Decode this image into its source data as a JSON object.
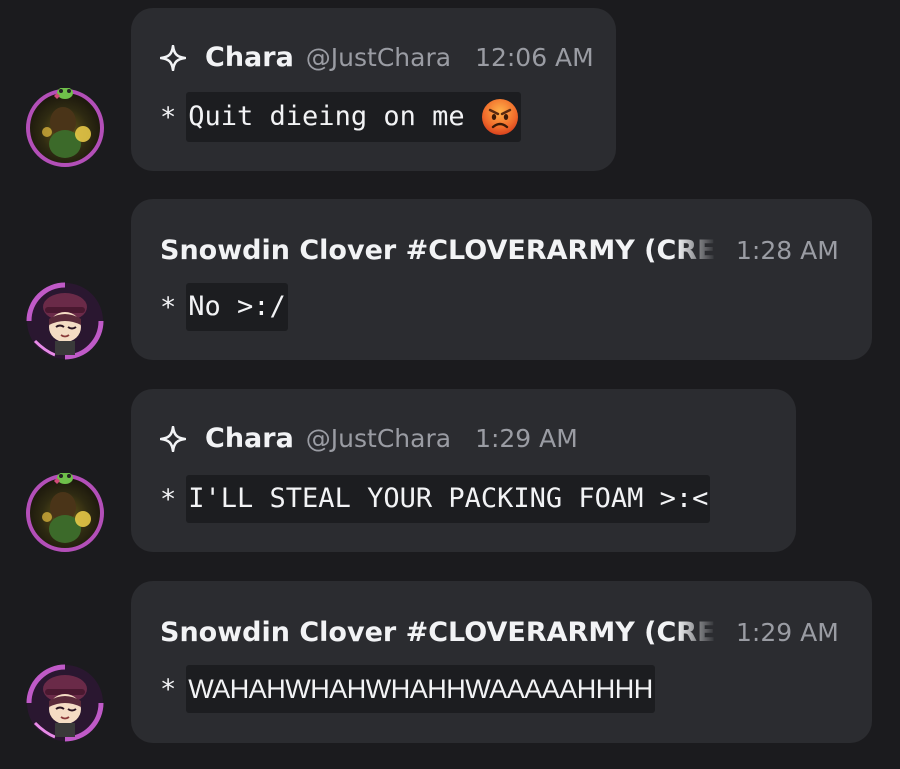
{
  "messages": [
    {
      "author": "Chara",
      "handle": "@JustChara",
      "time": "12:06 AM",
      "prefix": "*",
      "text": "Quit dieing on me",
      "emoji": "angry-face-icon",
      "avatar": "chara-avatar"
    },
    {
      "author": "Snowdin Clover #CLOVERARMY (CREATOR)",
      "time": "1:28 AM",
      "prefix": "*",
      "text": "No >:/",
      "avatar": "clover-avatar"
    },
    {
      "author": "Chara",
      "handle": "@JustChara",
      "time": "1:29 AM",
      "prefix": "*",
      "text": "I'LL STEAL YOUR PACKING FOAM >:<",
      "avatar": "chara-avatar"
    },
    {
      "author": "Snowdin Clover #CLOVERARMY (CREATOR)",
      "time": "1:29 AM",
      "prefix": "*",
      "text": "WAHAHWHAHWHAHHWAAAAAHHHH",
      "avatar": "clover-avatar"
    }
  ],
  "colors": {
    "background": "#1b1b1e",
    "bubble": "#2b2c30",
    "code_bg": "#1c1d20",
    "name": "#f2f3f5",
    "muted": "#9a9ca3"
  }
}
